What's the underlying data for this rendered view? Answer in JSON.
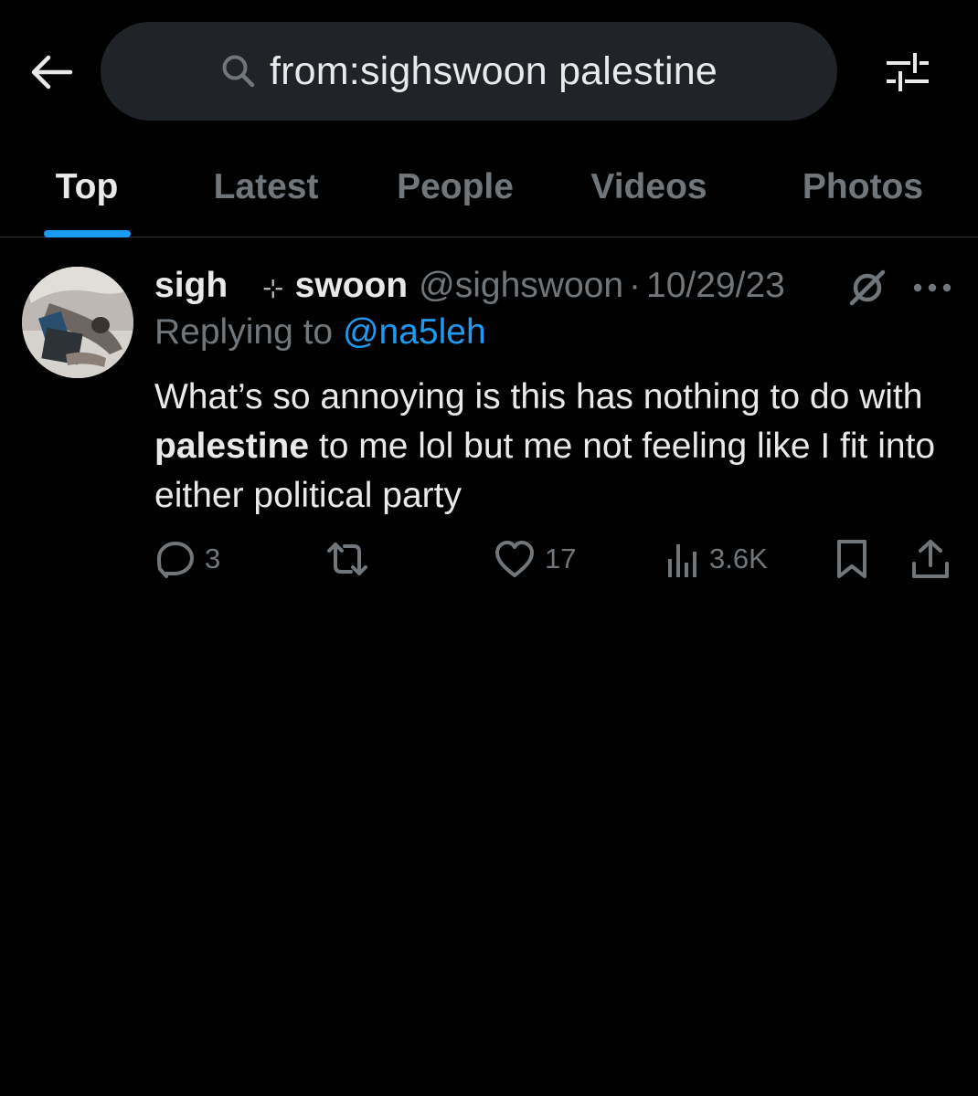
{
  "search": {
    "query": "from:sighswoon palestine"
  },
  "icons": {
    "back": "arrow-left-icon",
    "search": "search-icon",
    "filter": "filter-sliders-icon",
    "grok": "grok-icon",
    "more": "more-horizontal-icon",
    "reply": "reply-icon",
    "retweet": "retweet-icon",
    "like": "heart-icon",
    "views": "views-chart-icon",
    "bookmark": "bookmark-icon",
    "share": "share-icon"
  },
  "tabs": [
    {
      "label": "Top",
      "active": true
    },
    {
      "label": "Latest",
      "active": false
    },
    {
      "label": "People",
      "active": false
    },
    {
      "label": "Videos",
      "active": false
    },
    {
      "label": "Photos",
      "active": false
    }
  ],
  "tweet": {
    "display_name_first": "sigh",
    "sparkle": "⊹",
    "display_name_second": "swoon",
    "handle": "@sighswoon",
    "separator": "·",
    "date": "10/29/23",
    "replying_prefix": "Replying to ",
    "replying_to": "@na5leh",
    "text_part1": "What’s so annoying is this has nothing to do with ",
    "text_bold": "palestine",
    "text_part2": " to me lol but me not feeling like I fit into either political party",
    "stats": {
      "replies": "3",
      "retweets": "",
      "likes": "17",
      "views": "3.6K"
    }
  },
  "colors": {
    "background": "#000000",
    "search_bg": "#202327",
    "accent": "#1d9bf0",
    "text_primary": "#e7e9ea",
    "text_secondary": "#71767b",
    "divider": "#2f3336"
  }
}
